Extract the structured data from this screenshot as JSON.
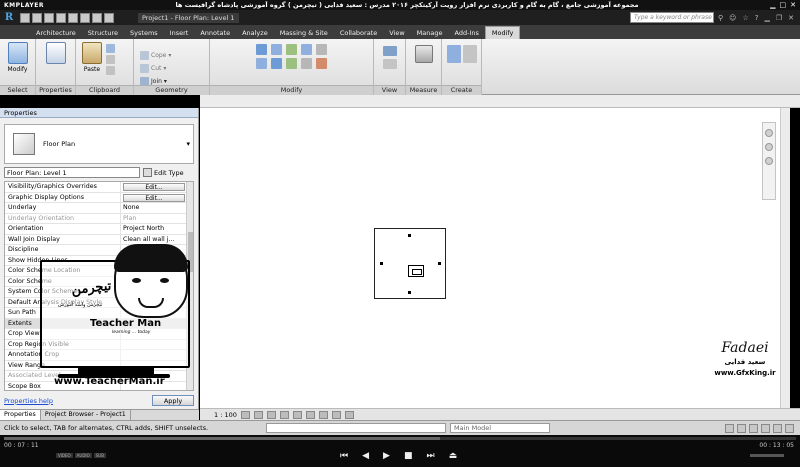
{
  "player": {
    "logo": "KMPLAYER",
    "title": "مجموعه آموزشی جامع ، گام به گام و کاربردی نرم افزار رویت آرکیتکچر ۲۰۱۶ مدرس : سعید فدایی ( تیچرمن ) گروه آموزشی پادشاه گرافیست ها",
    "current_time": "00 : 07 : 11",
    "total_time": "00 : 13 : 05",
    "badges": [
      "VIDEO",
      "AUDIO",
      "SUB"
    ],
    "seek_fraction": 0.55
  },
  "revit": {
    "doc_title": "Project1 - Floor Plan: Level 1",
    "search_placeholder": "Type a keyword or phrase"
  },
  "ribbon": {
    "tabs": [
      "Architecture",
      "Structure",
      "Systems",
      "Insert",
      "Annotate",
      "Analyze",
      "Massing & Site",
      "Collaborate",
      "View",
      "Manage",
      "Add-Ins",
      "Modify"
    ],
    "active_tab": "Modify",
    "modify_label": "Modify",
    "properties_label": "Properties",
    "paste_label": "Paste",
    "cope_label": "Cope",
    "cut_label": "Cut",
    "join_label": "Join",
    "panels": {
      "select": "Select",
      "properties": "Properties",
      "clipboard": "Clipboard",
      "geometry": "Geometry",
      "modify": "Modify",
      "view": "View",
      "measure": "Measure",
      "create": "Create"
    }
  },
  "properties": {
    "header": "Properties",
    "type_name": "Floor Plan",
    "instance_selector": "Floor Plan: Level 1",
    "edit_type": "Edit Type",
    "rows": [
      {
        "name": "Visibility/Graphics Overrides",
        "value": "Edit...",
        "button": true
      },
      {
        "name": "Graphic Display Options",
        "value": "Edit...",
        "button": true
      },
      {
        "name": "Underlay",
        "value": "None"
      },
      {
        "name": "Underlay Orientation",
        "value": "Plan",
        "disabled": true
      },
      {
        "name": "Orientation",
        "value": "Project North"
      },
      {
        "name": "Wall Join Display",
        "value": "Clean all wall j..."
      },
      {
        "name": "Discipline",
        "value": ""
      },
      {
        "name": "Show Hidden Lines",
        "value": ""
      },
      {
        "name": "Color Scheme Location",
        "value": ""
      },
      {
        "name": "Color Scheme",
        "value": ""
      },
      {
        "name": "System Color Schemes",
        "value": ""
      },
      {
        "name": "Default Analysis Display Style",
        "value": ""
      },
      {
        "name": "Sun Path",
        "value": ""
      },
      {
        "name": "Extents",
        "value": "",
        "group": true
      },
      {
        "name": "Crop View",
        "value": ""
      },
      {
        "name": "Crop Region Visible",
        "value": ""
      },
      {
        "name": "Annotation Crop",
        "value": ""
      },
      {
        "name": "View Range",
        "value": ""
      },
      {
        "name": "Associated Level",
        "value": "Level 1",
        "disabled": true
      },
      {
        "name": "Scope Box",
        "value": ""
      }
    ],
    "help_link": "Properties help",
    "apply": "Apply",
    "tabs": [
      "Properties",
      "Project Browser - Project1"
    ]
  },
  "watermark": {
    "logo_text": "تیچرمن",
    "logo_sub": "تیچرمن واسه آموزش",
    "title": "Teacher Man",
    "tagline": "learning ... today",
    "url": "www.TeacherMan.ir",
    "right_sig": "Fadaei",
    "right_name": "سعید فدایی",
    "right_site": "www.GfxKing.ir"
  },
  "view": {
    "scale": "1 : 100"
  },
  "status": {
    "text": "Click to select, TAB for alternates, CTRL adds, SHIFT unselects.",
    "model": "Main Model"
  }
}
